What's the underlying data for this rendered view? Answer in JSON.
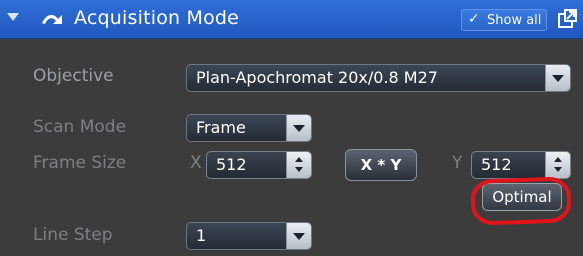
{
  "header": {
    "title": "Acquisition Mode",
    "show_all_label": "Show all",
    "colors": {
      "header_blue": "#2563c9",
      "panel_bg": "#3c3c3c"
    },
    "icons": [
      "collapse-triangle-icon",
      "acquisition-mode-icon",
      "checkmark-icon",
      "popout-icon"
    ]
  },
  "objective": {
    "label": "Objective",
    "value": "Plan-Apochromat 20x/0.8 M27"
  },
  "scan_mode": {
    "label": "Scan Mode",
    "value": "Frame"
  },
  "frame_size": {
    "label": "Frame Size",
    "x_label": "X",
    "x_value": "512",
    "xy_button": "X * Y",
    "y_label": "Y",
    "y_value": "512",
    "optimal_button": "Optimal"
  },
  "line_step": {
    "label": "Line Step",
    "value": "1"
  },
  "annotation_color": "#e3131b"
}
